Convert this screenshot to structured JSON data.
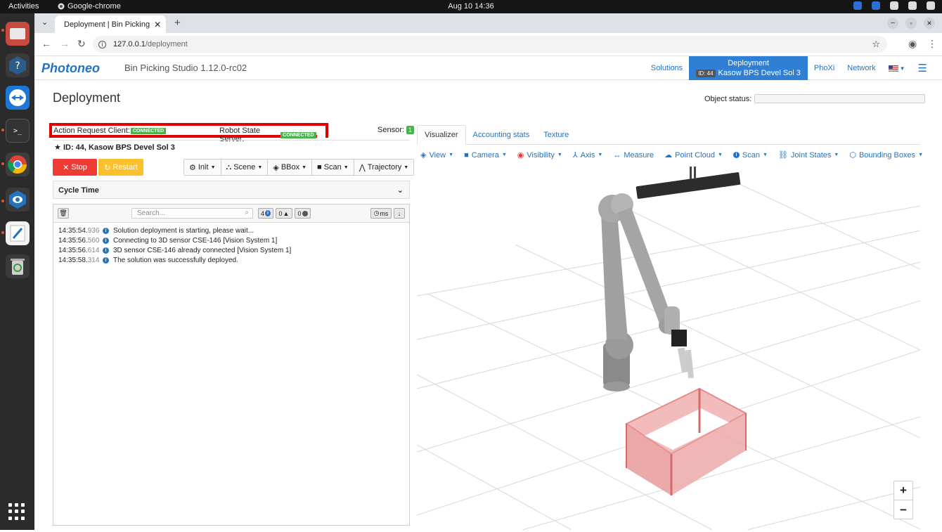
{
  "system_bar": {
    "activities": "Activities",
    "app_name": "Google-chrome",
    "clock": "Aug 10  14:36"
  },
  "browser": {
    "tab_title": "Deployment | Bin Picking",
    "url_host": "127.0.0.1",
    "url_path": "/deployment"
  },
  "header": {
    "logo": "Photoneo",
    "studio": "Bin Picking Studio 1.12.0-rc02",
    "nav": {
      "solutions": "Solutions",
      "deployment": "Deployment",
      "id_badge": "ID: 44",
      "deployment_sub": "Kasow BPS Devel Sol 3",
      "phoxi": "PhoXi",
      "network": "Network"
    }
  },
  "page": {
    "title": "Deployment",
    "object_status_label": "Object status:"
  },
  "status": {
    "action_client_label": "Action Request Client:",
    "action_client_state": "CONNECTED",
    "robot_server_label": "Robot State Server:",
    "robot_server_state": "CONNECTED",
    "sensor_label": "Sensor:",
    "sensor_count": "1"
  },
  "solution": {
    "title": "ID: 44, Kasow BPS Devel Sol 3"
  },
  "controls": {
    "stop": "Stop",
    "restart": "Restart",
    "init": "Init",
    "scene": "Scene",
    "bbox": "BBox",
    "scan": "Scan",
    "trajectory": "Trajectory"
  },
  "cycle": {
    "label": "Cycle Time"
  },
  "log": {
    "search_placeholder": "Search...",
    "info_count": "4",
    "warn_count": "0",
    "err_count": "0",
    "ms_label": "ms",
    "entries": [
      {
        "time": "14:35:54.",
        "ms": "936",
        "msg": "Solution deployment is starting, please wait..."
      },
      {
        "time": "14:35:56.",
        "ms": "560",
        "msg": "Connecting to 3D sensor CSE-146 [Vision System 1]"
      },
      {
        "time": "14:35:56.",
        "ms": "614",
        "msg": "3D sensor CSE-146 already connected [Vision System 1]"
      },
      {
        "time": "14:35:58.",
        "ms": "314",
        "msg": "The solution was successfully deployed."
      }
    ]
  },
  "visualizer": {
    "tabs": [
      "Visualizer",
      "Accounting stats",
      "Texture"
    ],
    "tools": {
      "view": "View",
      "camera": "Camera",
      "visibility": "Visibility",
      "axis": "Axis",
      "measure": "Measure",
      "point_cloud": "Point Cloud",
      "scan": "Scan",
      "joint_states": "Joint States",
      "bounding_boxes": "Bounding Boxes"
    },
    "zoom_in": "+",
    "zoom_out": "−"
  },
  "colors": {
    "accent": "#2573c0",
    "connected": "#4caf50",
    "stop": "#ef3b36",
    "restart": "#fbc02d",
    "highlight": "#e00000"
  }
}
